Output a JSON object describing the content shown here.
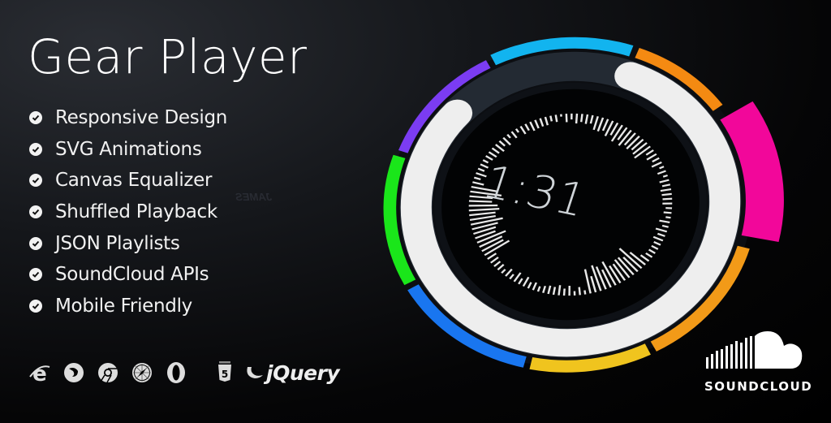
{
  "header": {
    "title": "Gear Player"
  },
  "features": [
    {
      "label": "Responsive Design",
      "icon": "check-circle-icon"
    },
    {
      "label": "SVG Animations",
      "icon": "check-circle-icon"
    },
    {
      "label": "Canvas Equalizer",
      "icon": "check-circle-icon"
    },
    {
      "label": "Shuffled Playback",
      "icon": "check-circle-icon"
    },
    {
      "label": "JSON Playlists",
      "icon": "check-circle-icon"
    },
    {
      "label": "SoundCloud APIs",
      "icon": "check-circle-icon"
    },
    {
      "label": "Mobile Friendly",
      "icon": "check-circle-icon"
    }
  ],
  "compatibility": {
    "browsers": [
      "internet-explorer-icon",
      "firefox-icon",
      "chrome-icon",
      "safari-icon",
      "opera-icon"
    ],
    "tech": [
      "html5-icon",
      "jquery-icon"
    ],
    "jquery_label": "jQuery"
  },
  "player": {
    "time": "1:31",
    "progress_ring_color": "#eeeeee",
    "segments": [
      {
        "name": "purple",
        "color": "#7b3cf2"
      },
      {
        "name": "cyan",
        "color": "#12b4ef"
      },
      {
        "name": "orange-top",
        "color": "#f48a12"
      },
      {
        "name": "pink",
        "color": "#f2079a"
      },
      {
        "name": "orange-bottom",
        "color": "#f29a18"
      },
      {
        "name": "yellow",
        "color": "#f0c41e"
      },
      {
        "name": "blue",
        "color": "#1976f0"
      },
      {
        "name": "green",
        "color": "#1ae61a"
      }
    ]
  },
  "soundcloud": {
    "label": "SOUNDCLOUD"
  },
  "background_text": [
    "JAMES"
  ]
}
